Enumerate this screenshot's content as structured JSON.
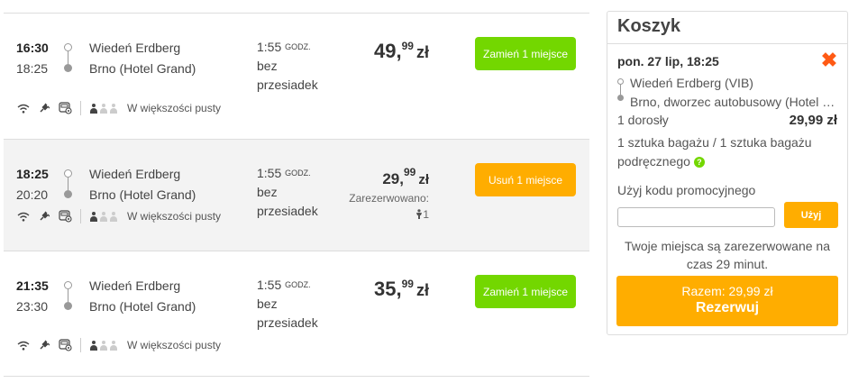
{
  "results": [
    {
      "departure": "16:30",
      "arrival": "18:25",
      "from": "Wiedeń Erdberg",
      "to": "Brno (Hotel Grand)",
      "duration": "1:55",
      "duration_unit": "godz.",
      "transfers_line1": "bez",
      "transfers_line2": "przesiadek",
      "price_int": "49,",
      "price_dec": "99",
      "currency": "zł",
      "button_label": "Zamień 1 miejsce",
      "occupancy": "W większości pusty",
      "selected": false
    },
    {
      "departure": "18:25",
      "arrival": "20:20",
      "from": "Wiedeń Erdberg",
      "to": "Brno (Hotel Grand)",
      "duration": "1:55",
      "duration_unit": "godz.",
      "transfers_line1": "bez",
      "transfers_line2": "przesiadek",
      "price_int": "29,",
      "price_dec": "99",
      "currency": "zł",
      "reserved_label": "Zarezerwowano:",
      "reserved_count": "1",
      "button_label": "Usuń 1 miejsce",
      "occupancy": "W większości pusty",
      "selected": true
    },
    {
      "departure": "21:35",
      "arrival": "23:30",
      "from": "Wiedeń Erdberg",
      "to": "Brno (Hotel Grand)",
      "duration": "1:55",
      "duration_unit": "godz.",
      "transfers_line1": "bez",
      "transfers_line2": "przesiadek",
      "price_int": "35,",
      "price_dec": "99",
      "currency": "zł",
      "button_label": "Zamień 1 miejsce",
      "occupancy": "W większości pusty",
      "selected": false
    }
  ],
  "cart": {
    "title": "Koszyk",
    "date": "pon. 27 lip, 18:25",
    "from": "Wiedeń Erdberg (VIB)",
    "to": "Brno, dworzec autobusowy (Hotel Grand)",
    "passengers": "1 dorosły",
    "passengers_price": "29,99 zł",
    "luggage": "1 sztuka bagażu / 1 sztuka bagażu podręcznego",
    "help_icon": "?",
    "promo_label": "Użyj kodu promocyjnego",
    "promo_value": "",
    "promo_button": "Użyj",
    "reserve_note": "Twoje miejsca są zarezerwowane na czas 29 minut.",
    "total": "Razem: 29,99 zł",
    "book_button": "Rezerwuj",
    "remove_icon": "✖"
  },
  "colors": {
    "green": "#73d700",
    "orange": "#ffad00",
    "remove": "#ff5a14"
  }
}
